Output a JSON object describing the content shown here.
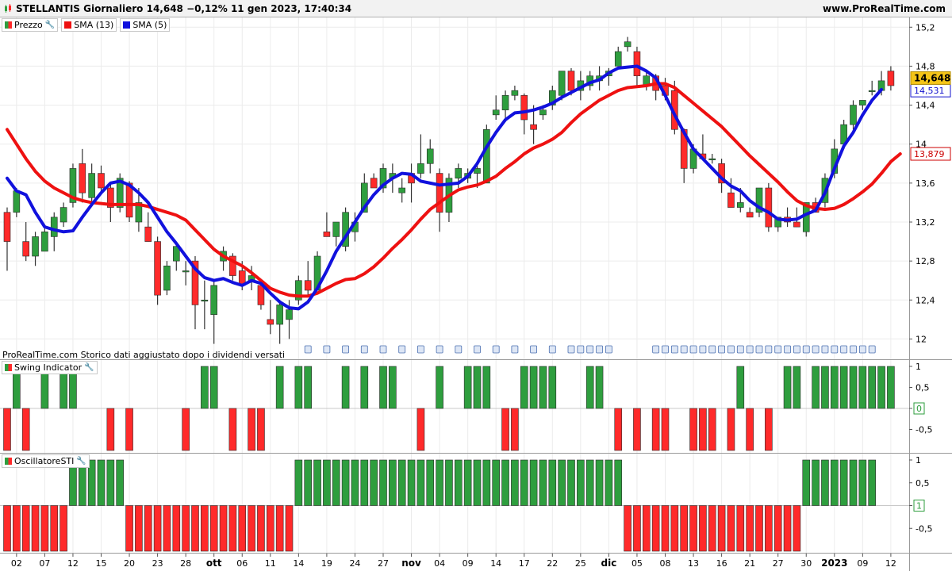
{
  "header": {
    "title": "STELLANTIS Giornaliero 14,648 −0,12% 11 gen 2023, 17:40:34",
    "site": "www.ProRealTime.com"
  },
  "legend": {
    "price": "Prezzo",
    "sma13": "SMA (13)",
    "sma5": "SMA (5)",
    "swing": "Swing Indicator",
    "sti": "OscillatoreSTI"
  },
  "note": "ProRealTime.com Storico dati aggiustato dopo i dividendi versati",
  "colors": {
    "up": "#2e9e3e",
    "down": "#ff2a2a",
    "sma13": "#ee1111",
    "sma5": "#1111dd",
    "badge": "#f5c518"
  },
  "chart_data": [
    {
      "type": "candlestick",
      "title": "STELLANTIS Giornaliero",
      "ylim": [
        11.8,
        15.3
      ],
      "yticks": [
        12,
        12.4,
        12.8,
        13.2,
        13.6,
        14,
        14.4,
        14.8,
        15.2
      ],
      "ytick_labels": [
        "12",
        "12,4",
        "12,8",
        "13,2",
        "13,6",
        "14",
        "14,4",
        "14,8",
        "15,2"
      ],
      "x_labels": [
        {
          "i": 1,
          "label": "02"
        },
        {
          "i": 4,
          "label": "07"
        },
        {
          "i": 7,
          "label": "12"
        },
        {
          "i": 10,
          "label": "15"
        },
        {
          "i": 13,
          "label": "20"
        },
        {
          "i": 16,
          "label": "23"
        },
        {
          "i": 19,
          "label": "28"
        },
        {
          "i": 22,
          "label": "ott",
          "bold": true
        },
        {
          "i": 25,
          "label": "06"
        },
        {
          "i": 28,
          "label": "11"
        },
        {
          "i": 31,
          "label": "14"
        },
        {
          "i": 34,
          "label": "19"
        },
        {
          "i": 37,
          "label": "24"
        },
        {
          "i": 40,
          "label": "27"
        },
        {
          "i": 43,
          "label": "nov",
          "bold": true
        },
        {
          "i": 46,
          "label": "04"
        },
        {
          "i": 49,
          "label": "09"
        },
        {
          "i": 52,
          "label": "14"
        },
        {
          "i": 55,
          "label": "17"
        },
        {
          "i": 58,
          "label": "22"
        },
        {
          "i": 61,
          "label": "25"
        },
        {
          "i": 64,
          "label": "dic",
          "bold": true
        },
        {
          "i": 67,
          "label": "05"
        },
        {
          "i": 70,
          "label": "08"
        },
        {
          "i": 73,
          "label": "13"
        },
        {
          "i": 76,
          "label": "16"
        },
        {
          "i": 79,
          "label": "21"
        },
        {
          "i": 82,
          "label": "27"
        },
        {
          "i": 85,
          "label": "30"
        },
        {
          "i": 88,
          "label": "2023",
          "bold": true
        },
        {
          "i": 91,
          "label": "09"
        },
        {
          "i": 94,
          "label": "12"
        }
      ],
      "candles": [
        [
          13.3,
          13.35,
          12.7,
          13.0
        ],
        [
          13.3,
          13.55,
          13.25,
          13.52
        ],
        [
          13.0,
          13.2,
          12.8,
          12.85
        ],
        [
          12.85,
          13.1,
          12.75,
          13.05
        ],
        [
          12.9,
          13.15,
          12.9,
          13.1
        ],
        [
          13.05,
          13.3,
          12.9,
          13.25
        ],
        [
          13.2,
          13.4,
          13.15,
          13.35
        ],
        [
          13.4,
          13.8,
          13.35,
          13.75
        ],
        [
          13.8,
          13.95,
          13.4,
          13.5
        ],
        [
          13.45,
          13.8,
          13.4,
          13.7
        ],
        [
          13.7,
          13.78,
          13.5,
          13.55
        ],
        [
          13.55,
          13.6,
          13.2,
          13.35
        ],
        [
          13.35,
          13.7,
          13.3,
          13.65
        ],
        [
          13.6,
          13.62,
          13.2,
          13.25
        ],
        [
          13.2,
          13.55,
          13.1,
          13.4
        ],
        [
          13.15,
          13.3,
          13.0,
          13.0
        ],
        [
          13.0,
          13.05,
          12.35,
          12.45
        ],
        [
          12.5,
          12.8,
          12.45,
          12.75
        ],
        [
          12.8,
          13.0,
          12.7,
          12.95
        ],
        [
          12.7,
          12.8,
          12.55,
          12.7
        ],
        [
          12.8,
          12.85,
          12.1,
          12.35
        ],
        [
          12.4,
          12.6,
          12.1,
          12.4
        ],
        [
          12.25,
          12.6,
          11.95,
          12.55
        ],
        [
          12.8,
          12.95,
          12.7,
          12.9
        ],
        [
          12.85,
          12.88,
          12.6,
          12.65
        ],
        [
          12.7,
          12.8,
          12.5,
          12.55
        ],
        [
          12.6,
          12.75,
          12.5,
          12.65
        ],
        [
          12.55,
          12.6,
          12.3,
          12.35
        ],
        [
          12.2,
          12.4,
          12.05,
          12.15
        ],
        [
          12.15,
          12.4,
          11.95,
          12.35
        ],
        [
          12.2,
          12.4,
          12.0,
          12.3
        ],
        [
          12.4,
          12.65,
          12.35,
          12.6
        ],
        [
          12.6,
          12.8,
          12.45,
          12.5
        ],
        [
          12.5,
          12.9,
          12.5,
          12.85
        ],
        [
          13.1,
          13.3,
          13.05,
          13.05
        ],
        [
          13.05,
          13.2,
          12.95,
          13.2
        ],
        [
          12.95,
          13.35,
          12.9,
          13.3
        ],
        [
          13.1,
          13.3,
          13.0,
          13.2
        ],
        [
          13.3,
          13.7,
          13.3,
          13.6
        ],
        [
          13.65,
          13.7,
          13.55,
          13.55
        ],
        [
          13.55,
          13.8,
          13.5,
          13.75
        ],
        [
          13.65,
          13.8,
          13.5,
          13.7
        ],
        [
          13.5,
          13.65,
          13.4,
          13.55
        ],
        [
          13.7,
          13.8,
          13.4,
          13.6
        ],
        [
          13.7,
          14.1,
          13.65,
          13.8
        ],
        [
          13.8,
          14.05,
          13.7,
          13.95
        ],
        [
          13.7,
          13.75,
          13.1,
          13.3
        ],
        [
          13.3,
          13.7,
          13.2,
          13.65
        ],
        [
          13.65,
          13.8,
          13.55,
          13.75
        ],
        [
          13.65,
          13.75,
          13.6,
          13.7
        ],
        [
          13.7,
          13.8,
          13.55,
          13.75
        ],
        [
          13.6,
          14.2,
          13.6,
          14.15
        ],
        [
          14.3,
          14.5,
          14.25,
          14.35
        ],
        [
          14.35,
          14.55,
          14.25,
          14.5
        ],
        [
          14.5,
          14.6,
          14.45,
          14.55
        ],
        [
          14.5,
          14.52,
          14.1,
          14.25
        ],
        [
          14.2,
          14.4,
          14.0,
          14.15
        ],
        [
          14.3,
          14.4,
          14.25,
          14.35
        ],
        [
          14.4,
          14.6,
          14.35,
          14.55
        ],
        [
          14.5,
          14.75,
          14.45,
          14.75
        ],
        [
          14.75,
          14.78,
          14.5,
          14.55
        ],
        [
          14.55,
          14.75,
          14.45,
          14.65
        ],
        [
          14.6,
          14.75,
          14.55,
          14.7
        ],
        [
          14.65,
          14.8,
          14.55,
          14.7
        ],
        [
          14.7,
          14.78,
          14.6,
          14.75
        ],
        [
          14.8,
          15.0,
          14.8,
          14.95
        ],
        [
          15.0,
          15.1,
          14.95,
          15.05
        ],
        [
          14.95,
          15.0,
          14.6,
          14.7
        ],
        [
          14.6,
          14.75,
          14.55,
          14.7
        ],
        [
          14.7,
          14.72,
          14.45,
          14.55
        ],
        [
          14.6,
          14.68,
          14.45,
          14.5
        ],
        [
          14.55,
          14.65,
          14.1,
          14.15
        ],
        [
          14.15,
          14.16,
          13.6,
          13.75
        ],
        [
          13.75,
          14.0,
          13.7,
          13.95
        ],
        [
          13.9,
          14.1,
          13.85,
          13.85
        ],
        [
          13.85,
          13.9,
          13.8,
          13.85
        ],
        [
          13.8,
          13.85,
          13.5,
          13.6
        ],
        [
          13.5,
          13.65,
          13.35,
          13.35
        ],
        [
          13.35,
          13.55,
          13.3,
          13.4
        ],
        [
          13.3,
          13.35,
          13.25,
          13.25
        ],
        [
          13.3,
          13.55,
          13.25,
          13.55
        ],
        [
          13.55,
          13.6,
          13.1,
          13.15
        ],
        [
          13.15,
          13.25,
          13.1,
          13.25
        ],
        [
          13.25,
          13.35,
          13.15,
          13.2
        ],
        [
          13.2,
          13.35,
          13.15,
          13.15
        ],
        [
          13.1,
          13.4,
          13.05,
          13.4
        ],
        [
          13.4,
          13.45,
          13.3,
          13.3
        ],
        [
          13.4,
          13.7,
          13.35,
          13.65
        ],
        [
          13.7,
          14.05,
          13.65,
          13.95
        ],
        [
          14.0,
          14.25,
          13.95,
          14.2
        ],
        [
          14.2,
          14.45,
          14.15,
          14.4
        ],
        [
          14.4,
          14.45,
          14.35,
          14.45
        ],
        [
          14.55,
          14.65,
          14.5,
          14.55
        ],
        [
          14.55,
          14.75,
          14.5,
          14.65
        ],
        [
          14.75,
          14.8,
          14.55,
          14.6
        ]
      ],
      "sma13": [
        14.15,
        14.0,
        13.85,
        13.72,
        13.62,
        13.55,
        13.5,
        13.45,
        13.42,
        13.4,
        13.39,
        13.38,
        13.38,
        13.38,
        13.38,
        13.36,
        13.33,
        13.3,
        13.27,
        13.22,
        13.12,
        13.02,
        12.92,
        12.85,
        12.8,
        12.75,
        12.68,
        12.6,
        12.52,
        12.48,
        12.45,
        12.44,
        12.44,
        12.47,
        12.52,
        12.57,
        12.61,
        12.62,
        12.67,
        12.74,
        12.83,
        12.93,
        13.02,
        13.12,
        13.23,
        13.33,
        13.4,
        13.47,
        13.53,
        13.56,
        13.58,
        13.62,
        13.67,
        13.75,
        13.82,
        13.9,
        13.96,
        14.0,
        14.05,
        14.12,
        14.22,
        14.31,
        14.38,
        14.45,
        14.5,
        14.55,
        14.58,
        14.59,
        14.6,
        14.62,
        14.62,
        14.58,
        14.5,
        14.42,
        14.34,
        14.26,
        14.18,
        14.08,
        13.98,
        13.88,
        13.79,
        13.7,
        13.61,
        13.51,
        13.42,
        13.37,
        13.34,
        13.33,
        13.34,
        13.38,
        13.44,
        13.51,
        13.59,
        13.7,
        13.82,
        13.9
      ],
      "sma5": [
        13.65,
        13.52,
        13.48,
        13.3,
        13.15,
        13.12,
        13.1,
        13.11,
        13.25,
        13.38,
        13.5,
        13.6,
        13.62,
        13.58,
        13.5,
        13.4,
        13.25,
        13.1,
        12.98,
        12.85,
        12.72,
        12.63,
        12.6,
        12.62,
        12.58,
        12.55,
        12.6,
        12.57,
        12.47,
        12.38,
        12.32,
        12.31,
        12.38,
        12.52,
        12.7,
        12.9,
        13.05,
        13.2,
        13.35,
        13.48,
        13.58,
        13.65,
        13.7,
        13.69,
        13.62,
        13.6,
        13.58,
        13.59,
        13.6,
        13.67,
        13.8,
        13.97,
        14.12,
        14.25,
        14.32,
        14.33,
        14.35,
        14.38,
        14.42,
        14.48,
        14.53,
        14.58,
        14.63,
        14.66,
        14.73,
        14.78,
        14.79,
        14.8,
        14.75,
        14.68,
        14.5,
        14.3,
        14.12,
        13.95,
        13.85,
        13.75,
        13.65,
        13.57,
        13.52,
        13.42,
        13.35,
        13.3,
        13.23,
        13.22,
        13.23,
        13.28,
        13.32,
        13.5,
        13.75,
        13.98,
        14.12,
        14.3,
        14.45,
        14.56
      ],
      "last_value": 14.648,
      "last_label": "14,648",
      "sma5_label": "14,531",
      "sma13_label": "13,879"
    },
    {
      "type": "bar",
      "title": "Swing Indicator",
      "ylim": [
        -1,
        1
      ],
      "yticks": [
        1,
        0.5,
        0,
        -0.5
      ],
      "ytick_labels": [
        "1",
        "0,5",
        "0",
        "-0,5"
      ],
      "last_label": "0",
      "values": [
        -1,
        1,
        -1,
        0,
        1,
        0,
        1,
        1,
        0,
        0,
        0,
        -1,
        0,
        -1,
        0,
        0,
        0,
        0,
        0,
        -1,
        0,
        1,
        1,
        0,
        -1,
        0,
        -1,
        -1,
        0,
        1,
        0,
        1,
        1,
        0,
        0,
        0,
        1,
        0,
        1,
        0,
        1,
        1,
        0,
        0,
        -1,
        0,
        1,
        0,
        0,
        1,
        1,
        1,
        0,
        -1,
        -1,
        1,
        1,
        1,
        1,
        0,
        0,
        0,
        1,
        1,
        0,
        -1,
        0,
        -1,
        0,
        -1,
        -1,
        0,
        0,
        -1,
        -1,
        -1,
        0,
        -1,
        1,
        -1,
        0,
        -1,
        0,
        1,
        1,
        0,
        1,
        1,
        1,
        1,
        1,
        1,
        1,
        1,
        1
      ]
    },
    {
      "type": "bar",
      "title": "OscillatoreSTI",
      "ylim": [
        -1,
        1
      ],
      "yticks": [
        1,
        0.5,
        0,
        -0.5
      ],
      "ytick_labels": [
        "1",
        "0,5",
        "0",
        "-0,5"
      ],
      "last_label": "1",
      "values": [
        -1,
        -1,
        -1,
        -1,
        -1,
        -1,
        -1,
        1,
        1,
        1,
        1,
        1,
        1,
        -1,
        -1,
        -1,
        -1,
        -1,
        -1,
        -1,
        -1,
        -1,
        -1,
        -1,
        -1,
        -1,
        -1,
        -1,
        -1,
        -1,
        -1,
        1,
        1,
        1,
        1,
        1,
        1,
        1,
        1,
        1,
        1,
        1,
        1,
        1,
        1,
        1,
        1,
        1,
        1,
        1,
        1,
        1,
        1,
        1,
        1,
        1,
        1,
        1,
        1,
        1,
        1,
        1,
        1,
        1,
        1,
        1,
        -1,
        -1,
        -1,
        -1,
        -1,
        -1,
        -1,
        -1,
        -1,
        -1,
        -1,
        -1,
        -1,
        -1,
        -1,
        -1,
        -1,
        -1,
        -1,
        1,
        1,
        1,
        1,
        1,
        1,
        1,
        1
      ]
    }
  ]
}
